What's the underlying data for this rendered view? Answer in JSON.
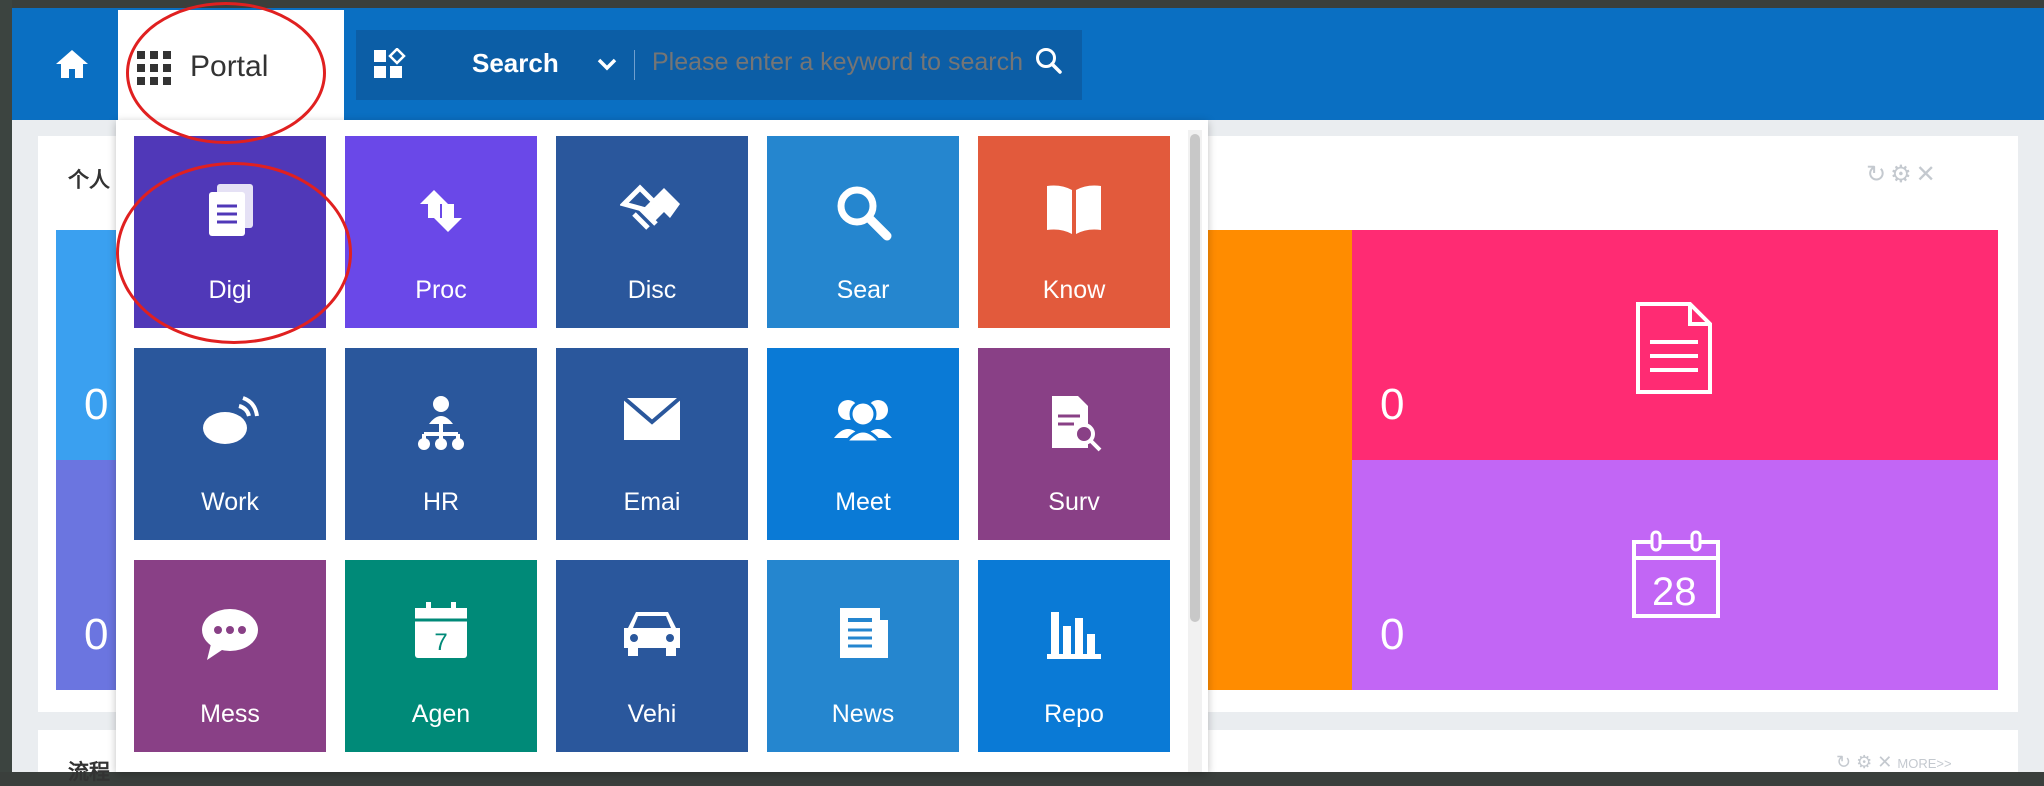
{
  "header": {
    "portal_label": "Portal",
    "search_mode": "Search",
    "search_placeholder": "Please enter a keyword to search"
  },
  "cards": {
    "personal_title": "个人",
    "process_title": "流程",
    "more_label": "MORE>>"
  },
  "stats": {
    "blue_value": "0",
    "lavender_value": "0",
    "pink_value": "0",
    "purple_value": "0",
    "calendar_day": "28"
  },
  "apps": [
    {
      "label": "Digi",
      "icon": "documents-icon",
      "color": "#5038b8"
    },
    {
      "label": "Proc",
      "icon": "process-icon",
      "color": "#6a48e8"
    },
    {
      "label": "Disc",
      "icon": "handshake-icon",
      "color": "#2a579c"
    },
    {
      "label": "Sear",
      "icon": "search-icon",
      "color": "#2586cf"
    },
    {
      "label": "Know",
      "icon": "book-icon",
      "color": "#e25a3c"
    },
    {
      "label": "Work",
      "icon": "work-icon",
      "color": "#2a579c"
    },
    {
      "label": "HR",
      "icon": "org-chart-icon",
      "color": "#2a579c"
    },
    {
      "label": "Emai",
      "icon": "envelope-icon",
      "color": "#2a579c"
    },
    {
      "label": "Meet",
      "icon": "people-icon",
      "color": "#0a7ad6"
    },
    {
      "label": "Surv",
      "icon": "survey-icon",
      "color": "#894086"
    },
    {
      "label": "Mess",
      "icon": "chat-bubble-icon",
      "color": "#894086"
    },
    {
      "label": "Agen",
      "icon": "calendar-icon",
      "color": "#008a78"
    },
    {
      "label": "Vehi",
      "icon": "car-icon",
      "color": "#2a579c"
    },
    {
      "label": "News",
      "icon": "newspaper-icon",
      "color": "#2586cf"
    },
    {
      "label": "Repo",
      "icon": "bar-chart-icon",
      "color": "#0a7ad6"
    }
  ],
  "agenda_icon_day": "7",
  "colors": {
    "topbar": "#0a6fc2",
    "annotation_ring": "#e02020"
  }
}
